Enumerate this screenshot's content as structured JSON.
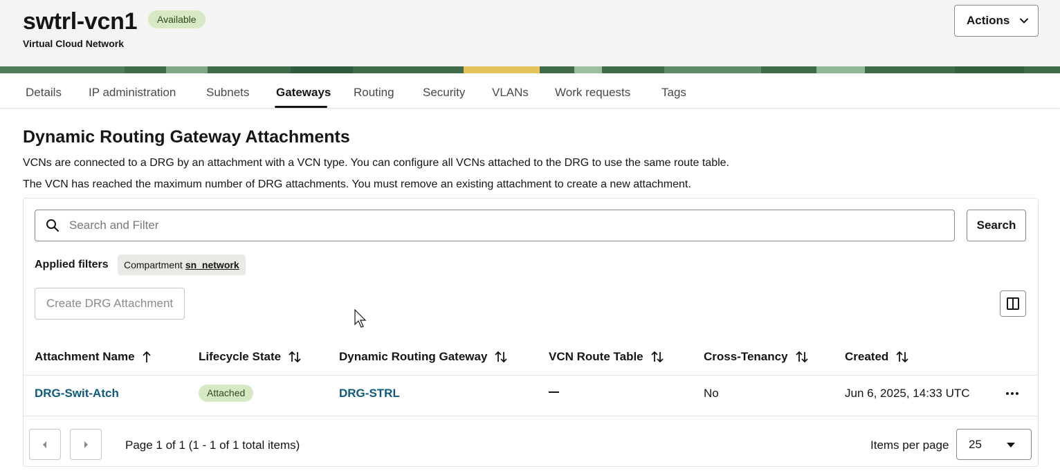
{
  "header": {
    "title": "swtrl-vcn1",
    "status": "Available",
    "subtitle": "Virtual Cloud Network",
    "actions_label": "Actions"
  },
  "tabs": [
    {
      "label": "Details"
    },
    {
      "label": "IP administration"
    },
    {
      "label": "Subnets"
    },
    {
      "label": "Gateways",
      "active": true
    },
    {
      "label": "Routing"
    },
    {
      "label": "Security"
    },
    {
      "label": "VLANs"
    },
    {
      "label": "Work requests"
    },
    {
      "label": "Tags"
    }
  ],
  "section": {
    "title": "Dynamic Routing Gateway Attachments",
    "description": "VCNs are connected to a DRG by an attachment with a VCN type. You can configure all VCNs attached to the DRG to use the same route table.",
    "warning": "The VCN has reached the maximum number of DRG attachments. You must remove an existing attachment to create a new attachment."
  },
  "search": {
    "placeholder": "Search and Filter",
    "button_label": "Search"
  },
  "filters": {
    "label": "Applied filters",
    "chip_key": "Compartment",
    "chip_value": "sn_network"
  },
  "toolbar": {
    "create_label": "Create DRG Attachment"
  },
  "table": {
    "columns": [
      {
        "label": "Attachment Name",
        "sort": "ascending"
      },
      {
        "label": "Lifecycle State",
        "sort": "none"
      },
      {
        "label": "Dynamic Routing Gateway",
        "sort": "none"
      },
      {
        "label": "VCN Route Table",
        "sort": "none"
      },
      {
        "label": "Cross-Tenancy",
        "sort": "none"
      },
      {
        "label": "Created",
        "sort": "none"
      }
    ],
    "rows": [
      {
        "name": "DRG-Swit-Atch",
        "lifecycle": "Attached",
        "drg": "DRG-STRL",
        "route_table": "—",
        "cross_tenancy": "No",
        "created": "Jun 6, 2025, 14:33 UTC"
      }
    ]
  },
  "pagination": {
    "summary": "Page 1 of 1 (1 - 1 of 1 total items)",
    "items_per_page_label": "Items per page",
    "items_per_page": "25"
  },
  "colors": {
    "status_green_bg": "#d6e9c4",
    "link": "#0e5a7a",
    "header_bg": "#f5f4f2"
  }
}
